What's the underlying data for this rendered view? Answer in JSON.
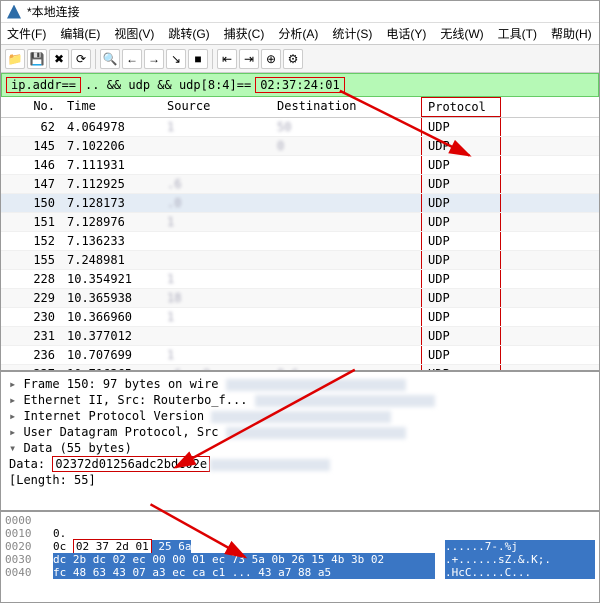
{
  "window": {
    "title": "*本地连接"
  },
  "menu": {
    "file": "文件(F)",
    "edit": "编辑(E)",
    "view": "视图(V)",
    "go": "跳转(G)",
    "capture": "捕获(C)",
    "analyze": "分析(A)",
    "stats": "统计(S)",
    "tele": "电话(Y)",
    "wireless": "无线(W)",
    "tools": "工具(T)",
    "help": "帮助(H)"
  },
  "filter": {
    "prefix": "ip.addr==",
    "mid": ".. && udp && udp[8:4]",
    "eq": " == ",
    "val": "02:37:24:01"
  },
  "cols": {
    "no": "No.",
    "time": "Time",
    "src": "Source",
    "dst": "Destination",
    "proto": "Protocol"
  },
  "rows": [
    {
      "no": "62",
      "time": "4.064978",
      "src": "1",
      "dst": "50",
      "proto": "UDP"
    },
    {
      "no": "145",
      "time": "7.102206",
      "src": "",
      "dst": "0",
      "proto": "UDP"
    },
    {
      "no": "146",
      "time": "7.111931",
      "src": "",
      "dst": "",
      "proto": "UDP"
    },
    {
      "no": "147",
      "time": "7.112925",
      "src": ".6",
      "dst": "",
      "proto": "UDP"
    },
    {
      "no": "150",
      "time": "7.128173",
      "src": ".0",
      "dst": "",
      "proto": "UDP"
    },
    {
      "no": "151",
      "time": "7.128976",
      "src": "1",
      "dst": "",
      "proto": "UDP"
    },
    {
      "no": "152",
      "time": "7.136233",
      "src": "",
      "dst": "",
      "proto": "UDP"
    },
    {
      "no": "155",
      "time": "7.248981",
      "src": "",
      "dst": "",
      "proto": "UDP"
    },
    {
      "no": "228",
      "time": "10.354921",
      "src": "1",
      "dst": "",
      "proto": "UDP"
    },
    {
      "no": "229",
      "time": "10.365938",
      "src": "18",
      "dst": "",
      "proto": "UDP"
    },
    {
      "no": "230",
      "time": "10.366960",
      "src": "1",
      "dst": "",
      "proto": "UDP"
    },
    {
      "no": "231",
      "time": "10.377012",
      "src": "",
      "dst": "",
      "proto": "UDP"
    },
    {
      "no": "236",
      "time": "10.707699",
      "src": "1",
      "dst": "",
      "proto": "UDP"
    },
    {
      "no": "237",
      "time": "10.716365",
      "src": ".6.  .9",
      "dst": "8.6",
      "proto": "UDP"
    }
  ],
  "details": {
    "frame": "Frame 150: 97 bytes on wire",
    "eth": "Ethernet II, Src: Routerbo_f...",
    "ip": "Internet Protocol Version",
    "udp": "User Datagram Protocol, Src",
    "data_hdr": "Data (55 bytes)",
    "data_lbl": "Data: ",
    "data_val": "02372d01256adc2bdc02e",
    "len": "[Length: 55]"
  },
  "hex": {
    "offs": [
      "0000",
      "0010",
      "0020",
      "0030",
      "0040"
    ],
    "r0": {
      "b": "",
      "a": ""
    },
    "r1": {
      "b": "0.",
      "a": ""
    },
    "r2": {
      "b_pre": "0c                       ",
      "hl": "02 37 2d 01",
      "b_post": " 25 6a",
      "a": "......7-.%j"
    },
    "r3": {
      "b": "dc 2b dc 02 ec 00 00 01 ec  73 5a 0b 26 15 4b 3b 02",
      "a": ".+......sZ.&.K;."
    },
    "r4": {
      "b": "fc 48 63 43 07 a3 ec ca c1 ...  43 a7 88 a5",
      "a": ".HcC.....C..."
    }
  },
  "icons": {
    "open": "📁",
    "save": "💾",
    "close": "✖",
    "reload": "⟳",
    "find": "🔍",
    "back": "←",
    "fwd": "→",
    "goto": "↘",
    "stop": "■",
    "first": "⇤",
    "last": "⇥",
    "zoom": "⊕",
    "cfg": "⚙"
  }
}
